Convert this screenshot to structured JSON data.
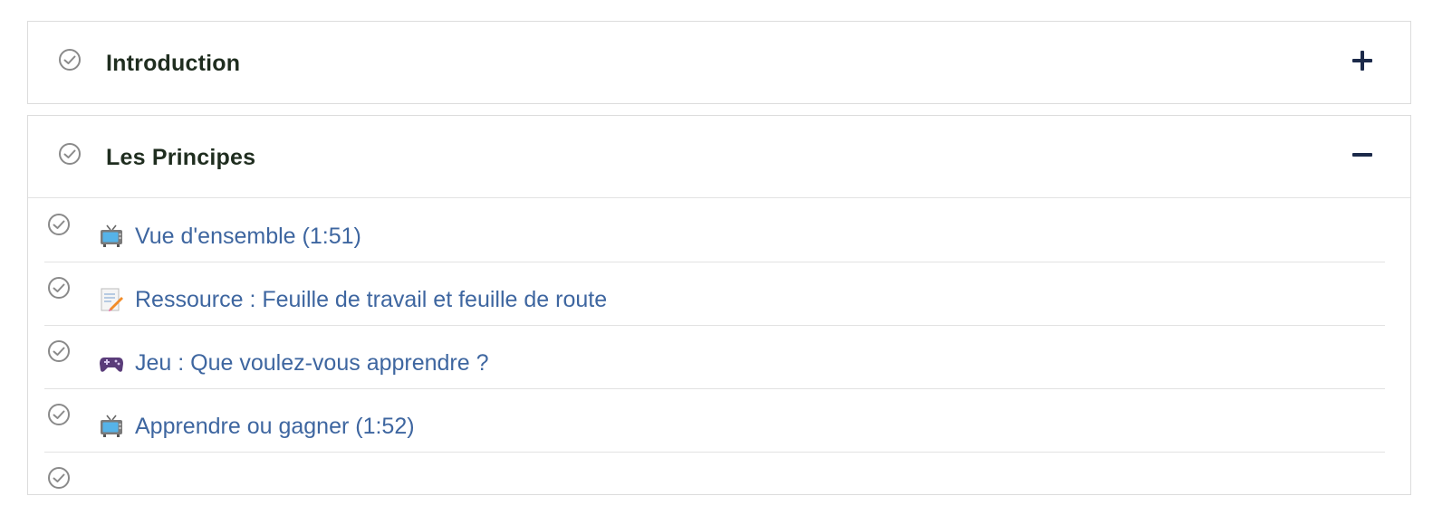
{
  "sections": [
    {
      "title": "Introduction",
      "toggle": "expand",
      "completed": true
    },
    {
      "title": "Les Principes",
      "toggle": "collapse",
      "completed": true,
      "lessons": [
        {
          "label": "Vue d'ensemble (1:51)",
          "icon": "tv-icon",
          "completed": true
        },
        {
          "label": "Ressource : Feuille de travail et feuille de route",
          "icon": "memo-icon",
          "completed": true
        },
        {
          "label": "Jeu : Que voulez-vous apprendre ?",
          "icon": "game-controller-icon",
          "completed": true
        },
        {
          "label": "Apprendre ou gagner (1:52)",
          "icon": "tv-icon",
          "completed": true
        }
      ]
    }
  ],
  "colors": {
    "section_title": "#1f2d1f",
    "lesson_link": "#3e66a0",
    "toggle_icon": "#1c2a4a",
    "check_icon": "#8a8a8a",
    "border": "#dcdcdc"
  }
}
